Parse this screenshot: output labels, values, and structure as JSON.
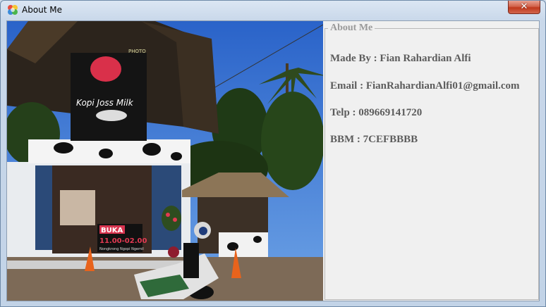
{
  "window": {
    "title": "About Me",
    "close_glyph": "✕",
    "icon": "app-icon"
  },
  "group": {
    "legend": "About Me"
  },
  "info": {
    "made_by": "Made By : Fian Rahardian Alfi",
    "email": "Email : FianRahardianAlfi01@gmail.com",
    "telp": "Telp : 089669141720",
    "bbm": "BBM : 7CEFBBBB"
  },
  "photo": {
    "sign_text": "Kopi Joss Milk",
    "sign_top": "PHOTO",
    "buka": "BUKA",
    "hours": "11.00-02.00",
    "sub": "Nongkrong Ngopi Ngemil"
  }
}
